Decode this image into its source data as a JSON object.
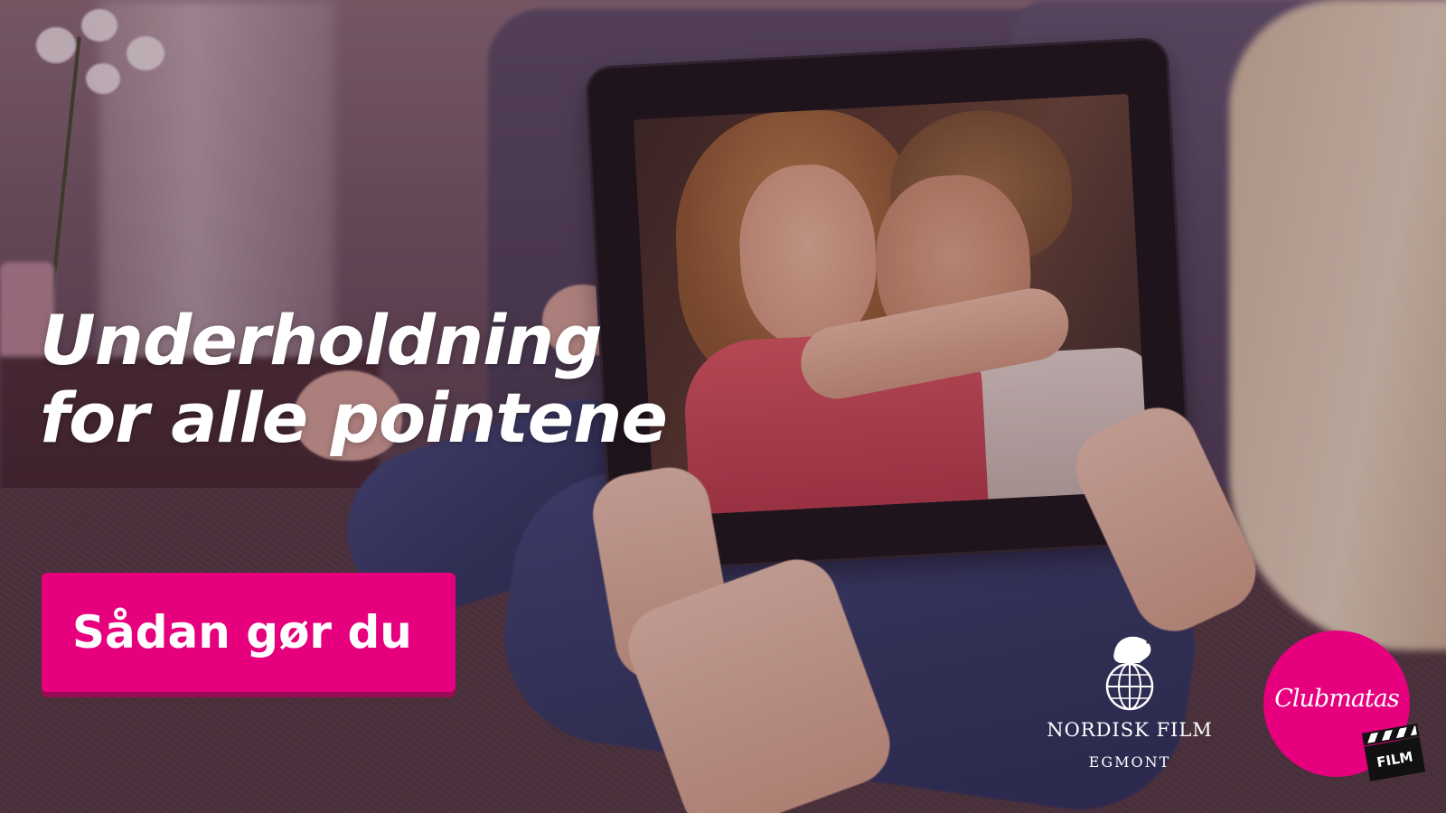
{
  "banner": {
    "headline_line1": "Underholdning",
    "headline_line2": "for alle pointene",
    "cta_label": "Sådan gør du"
  },
  "logos": {
    "nordisk_film": {
      "name": "NORDISK FILM",
      "sub": "EGMONT",
      "icon": "polar-bear-globe-icon"
    },
    "club_matas": {
      "name": "Clubmatas",
      "badge": "FILM",
      "icon": "clapperboard-icon"
    }
  },
  "colors": {
    "accent": "#e6007e",
    "accent_shadow": "#9b0a55",
    "text": "#ffffff"
  }
}
